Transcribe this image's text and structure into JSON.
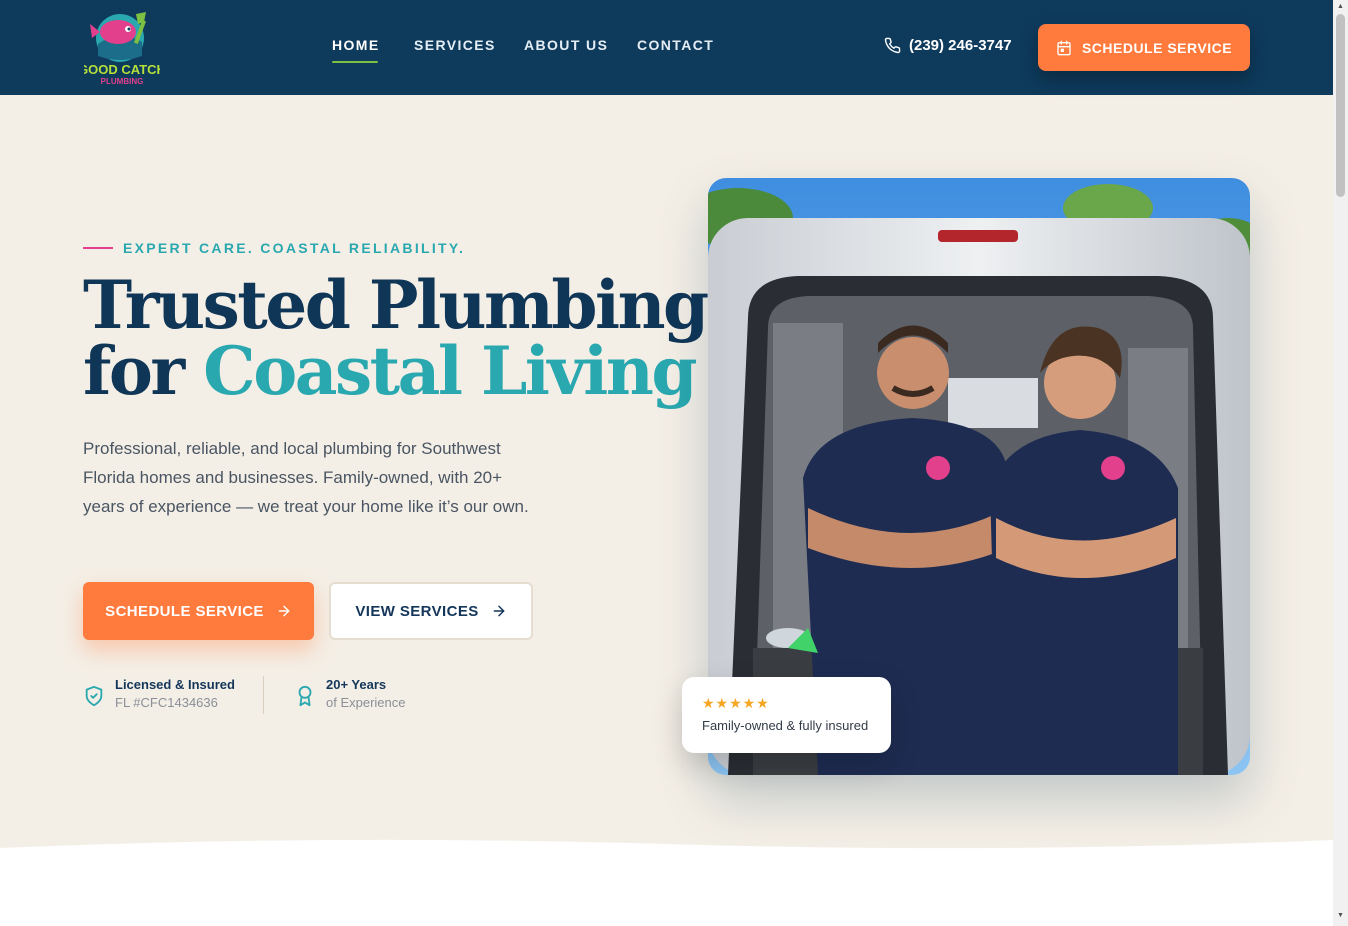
{
  "brand": {
    "logo_line1": "GOOD CATCH",
    "logo_line2": "PLUMBING"
  },
  "nav": {
    "items": [
      {
        "label": "HOME",
        "active": true
      },
      {
        "label": "SERVICES",
        "active": false
      },
      {
        "label": "ABOUT US",
        "active": false
      },
      {
        "label": "CONTACT",
        "active": false
      }
    ]
  },
  "header": {
    "phone": "(239) 246-3747",
    "cta_label": "SCHEDULE SERVICE",
    "cta_icon": "calendar-icon"
  },
  "hero": {
    "eyebrow": "EXPERT CARE. COASTAL RELIABILITY.",
    "headline_line1": "Trusted Plumbing",
    "headline_line2_prefix": "for ",
    "headline_line2_accent": "Coastal Living",
    "lead": "Professional, reliable, and local plumbing for Southwest Florida homes and businesses. Family-owned, with 20+ years of experience — we treat your home like it’s our own.",
    "primary_cta": "SCHEDULE SERVICE",
    "secondary_cta": "VIEW SERVICES",
    "trust": [
      {
        "icon": "shield-check-icon",
        "title": "Licensed & Insured",
        "sub": "FL #CFC1434636"
      },
      {
        "icon": "award-icon",
        "title": "20+ Years",
        "sub": "of Experience"
      }
    ],
    "review_card": {
      "stars": "★★★★★",
      "text": "Family-owned & fully insured"
    }
  },
  "colors": {
    "header_bg": "#0e3a5c",
    "accent_orange": "#ff7a3d",
    "accent_teal": "#2aa8b0",
    "accent_pink": "#e23f8c",
    "page_bg": "#f4efe6"
  }
}
